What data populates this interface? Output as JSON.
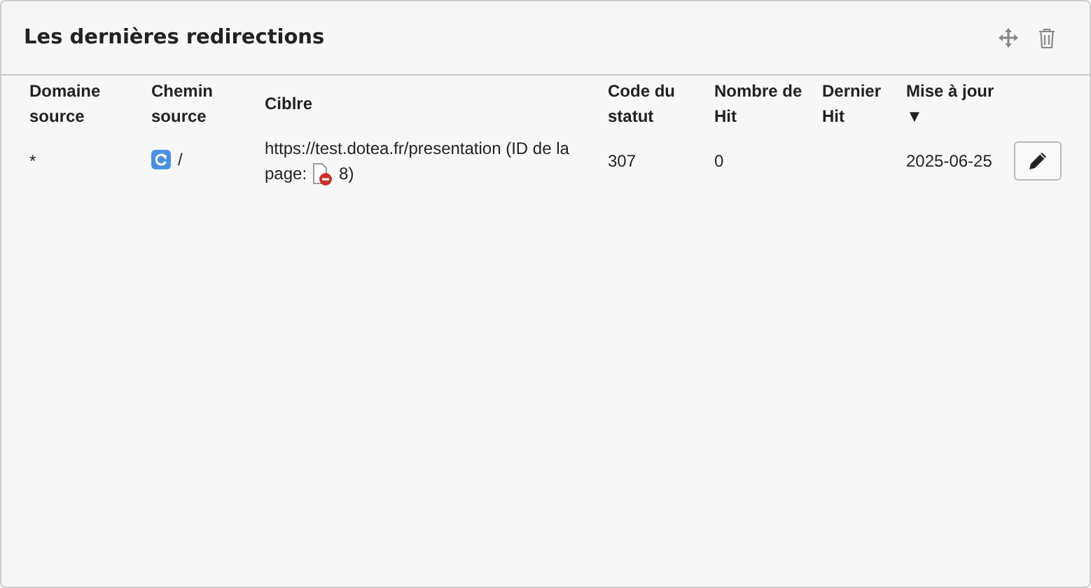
{
  "panel": {
    "title": "Les dernières redirections"
  },
  "table": {
    "columns": [
      {
        "label": "Domaine source"
      },
      {
        "label": "Chemin source"
      },
      {
        "label": "Ciblre"
      },
      {
        "label": "Code du statut"
      },
      {
        "label": "Nombre de Hit"
      },
      {
        "label": "Dernier Hit"
      },
      {
        "label": "Mise à jour",
        "sort": "▼"
      }
    ],
    "rows": [
      {
        "domain": "*",
        "path": "/",
        "target": "https://test.dotea.fr/presentation (ID de la",
        "target_label": "page:",
        "target_end": "8)",
        "status": "307",
        "hits": "0",
        "updated": "2025-06-25"
      }
    ]
  }
}
